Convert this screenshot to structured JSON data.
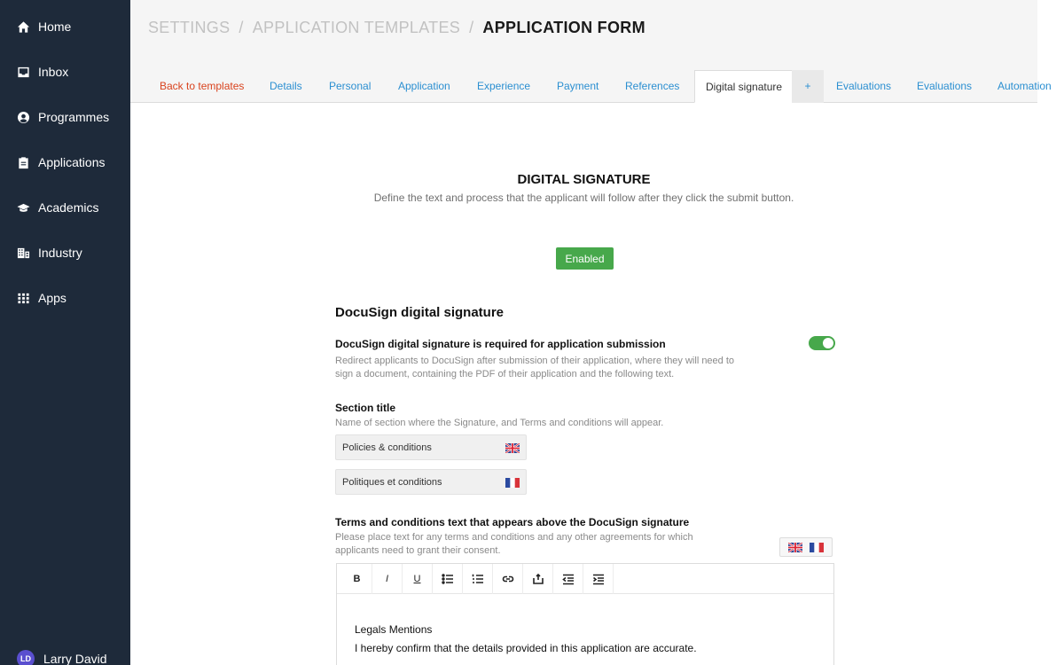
{
  "sidebar": {
    "items": [
      {
        "label": "Home",
        "icon": "home-icon"
      },
      {
        "label": "Inbox",
        "icon": "inbox-icon"
      },
      {
        "label": "Programmes",
        "icon": "graduate-icon"
      },
      {
        "label": "Applications",
        "icon": "clipboard-icon"
      },
      {
        "label": "Academics",
        "icon": "mortarboard-icon"
      },
      {
        "label": "Industry",
        "icon": "building-icon"
      },
      {
        "label": "Apps",
        "icon": "grid-icon"
      }
    ],
    "user": {
      "initials": "LD",
      "name": "Larry David"
    }
  },
  "breadcrumb": {
    "root": "SETTINGS",
    "parent": "APPLICATION TEMPLATES",
    "current": "APPLICATION FORM",
    "separator": "/"
  },
  "tabs": {
    "back": "Back to templates",
    "items": [
      "Details",
      "Personal",
      "Application",
      "Experience",
      "Payment",
      "References",
      "Digital signature",
      "+",
      "Evaluations",
      "Evaluations",
      "Automation"
    ],
    "active": "Digital signature"
  },
  "section": {
    "title": "DIGITAL SIGNATURE",
    "subtitle": "Define the text and process that the applicant will follow after they click the submit button.",
    "status_button": "Enabled"
  },
  "docusign": {
    "heading": "DocuSign digital signature",
    "required_label": "DocuSign digital signature is required for application submission",
    "required_help_1": "Redirect applicants to DocuSign after submission of their application, where they will need to",
    "required_help_2": "sign a document, containing the PDF of their application and the following text.",
    "required_enabled": true,
    "section_title_label": "Section title",
    "section_title_help": "Name of section where the Signature, and Terms and conditions will appear.",
    "section_title_en": "Policies & conditions",
    "section_title_fr": "Politiques et conditions",
    "terms_label": "Terms and conditions text that appears above the DocuSign signature",
    "terms_help_1": "Please place text for any terms and conditions and any other agreements for which",
    "terms_help_2": "applicants need to grant their consent.",
    "editor_toolbar": [
      "B",
      "I",
      "U"
    ],
    "editor_lines": [
      "Legals Mentions",
      "I hereby confirm that the details provided in this application are accurate."
    ]
  },
  "colors": {
    "sidebar": "#1e2a3a",
    "accent_blue": "#2b8fd1",
    "back_red": "#d9431e",
    "success_green": "#47a84b"
  }
}
